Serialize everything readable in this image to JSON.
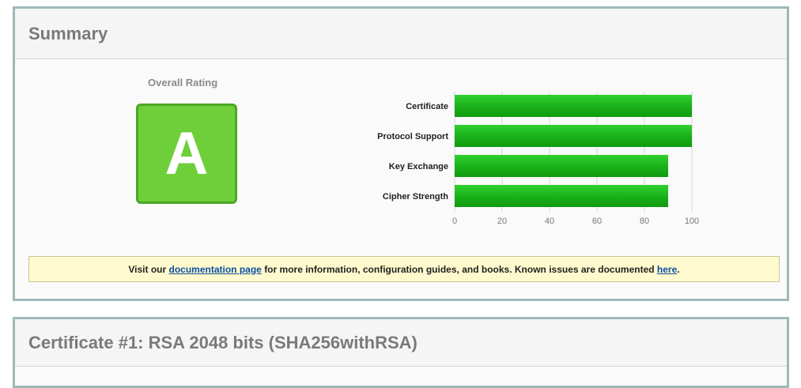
{
  "summary": {
    "title": "Summary",
    "overall_rating_label": "Overall Rating",
    "grade": "A",
    "notice": {
      "prefix": "Visit our ",
      "doc_link": "documentation page",
      "middle": " for more information, configuration guides, and books. Known issues are documented ",
      "here_link": "here",
      "suffix": "."
    }
  },
  "chart_data": {
    "type": "bar",
    "orientation": "horizontal",
    "categories": [
      "Certificate",
      "Protocol Support",
      "Key Exchange",
      "Cipher Strength"
    ],
    "values": [
      100,
      100,
      90,
      90
    ],
    "xlim": [
      0,
      100
    ],
    "ticks": [
      "0",
      "20",
      "40",
      "60",
      "80",
      "100"
    ],
    "tick_values": [
      0,
      20,
      40,
      60,
      80,
      100
    ],
    "grid": true,
    "bar_color": "#19b019"
  },
  "certificate": {
    "title": "Certificate #1: RSA 2048 bits (SHA256withRSA)"
  },
  "colors": {
    "grade_fill": "#6ecf3b",
    "grade_border": "#4aa824",
    "panel_border": "#9fb8ba",
    "notice_bg": "#fffacd",
    "link": "#0b4ea2"
  }
}
